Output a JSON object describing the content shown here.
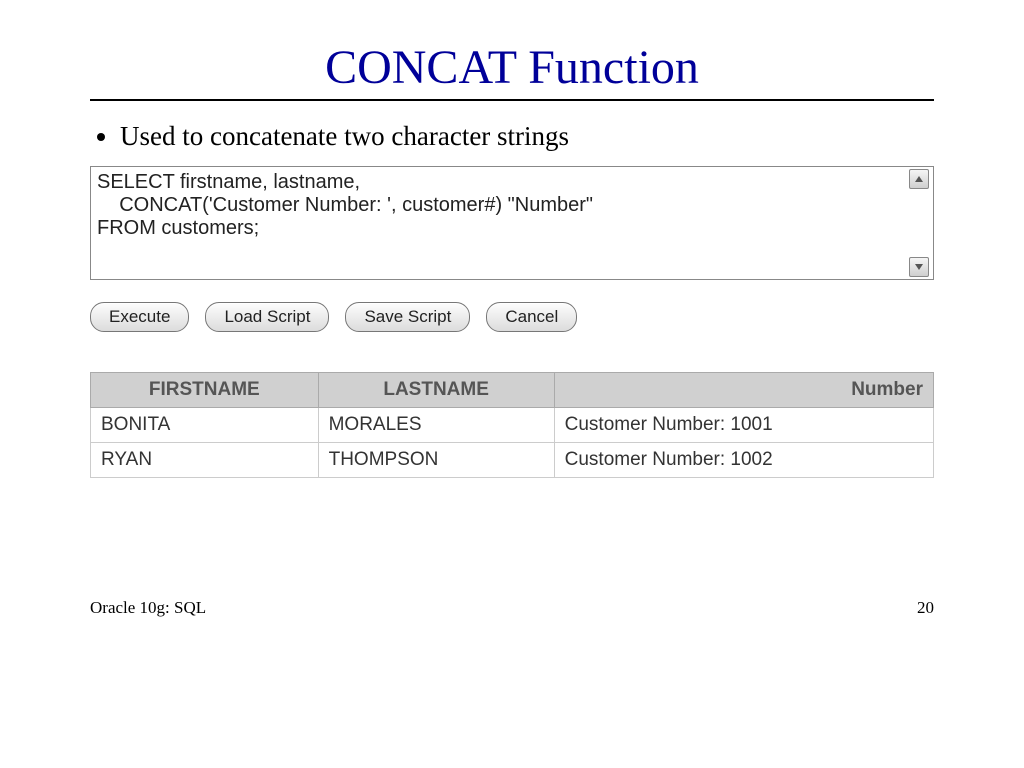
{
  "title": "CONCAT Function",
  "bullet": "Used to concatenate two character strings",
  "sql": "SELECT firstname, lastname,\n    CONCAT('Customer Number: ', customer#) \"Number\"\nFROM customers;",
  "buttons": {
    "execute": "Execute",
    "load": "Load Script",
    "save": "Save Script",
    "cancel": "Cancel"
  },
  "table": {
    "headers": {
      "c1": "FIRSTNAME",
      "c2": "LASTNAME",
      "c3": "Number"
    },
    "rows": [
      {
        "c1": "BONITA",
        "c2": "MORALES",
        "c3": "Customer Number: 1001"
      },
      {
        "c1": "RYAN",
        "c2": "THOMPSON",
        "c3": "Customer Number: 1002"
      }
    ]
  },
  "footer": {
    "left": "Oracle 10g: SQL",
    "right": "20"
  }
}
